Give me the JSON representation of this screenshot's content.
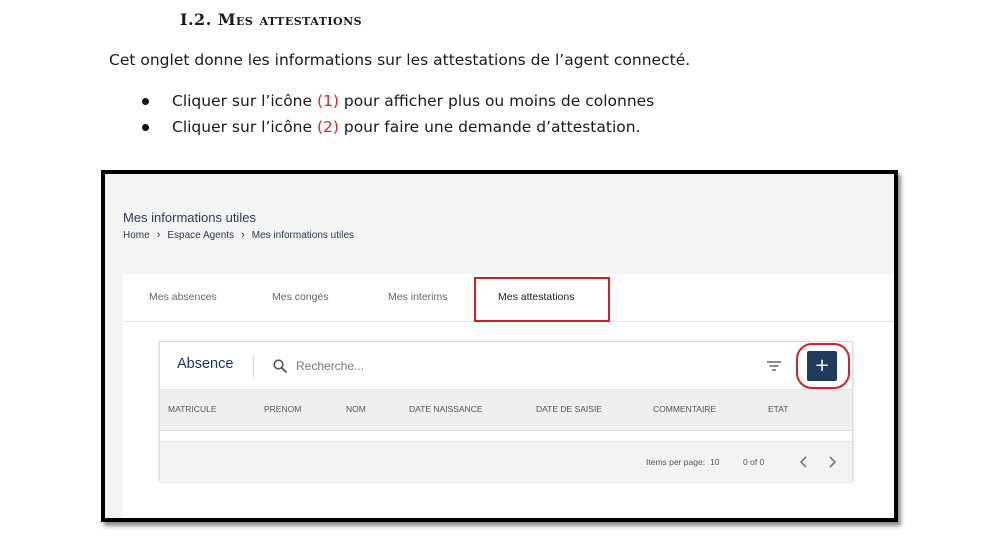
{
  "document": {
    "heading": "I.2. Mes attestations",
    "intro": "Cet onglet donne les informations sur les attestations de l’agent connecté.",
    "bullets": [
      {
        "pre": "Cliquer sur l’icône ",
        "marker": "(1)",
        "post": " pour  afficher plus ou moins de colonnes"
      },
      {
        "pre": "Cliquer sur l’icône ",
        "marker": "(2)",
        "post": " pour faire une demande d’attestation."
      }
    ]
  },
  "app": {
    "title": "Mes informations utiles",
    "breadcrumb": [
      "Home",
      "Espace Agents",
      "Mes informations utiles"
    ],
    "tabs": [
      "Mes absences",
      "Mes congés",
      "Mes interims",
      "Mes attestations"
    ],
    "active_tab": "Mes attestations",
    "table": {
      "title": "Absence",
      "search_placeholder": "Recherche...",
      "add_label": "+",
      "columns": [
        "MATRICULE",
        "PRENOM",
        "NOM",
        "DATE NAISSANCE",
        "DATE DE SAISIE",
        "COMMENTAIRE",
        "ETAT"
      ],
      "rows": [],
      "paginator": {
        "items_per_page_label": "Items per page:",
        "items_per_page": "10",
        "range": "0 of 0"
      }
    }
  },
  "icons": {
    "bullet": "bullet-dot",
    "breadcrumb_separator": "chevron-right-icon",
    "search": "search-icon",
    "filter": "filter-lines-icon",
    "prev": "chevron-left-icon",
    "next": "chevron-right-icon"
  },
  "colors": {
    "highlight_red": "#d81f26",
    "marker_red": "#d22b2b",
    "primary_navy": "#203b5a",
    "title_navy": "#1c2f55"
  }
}
